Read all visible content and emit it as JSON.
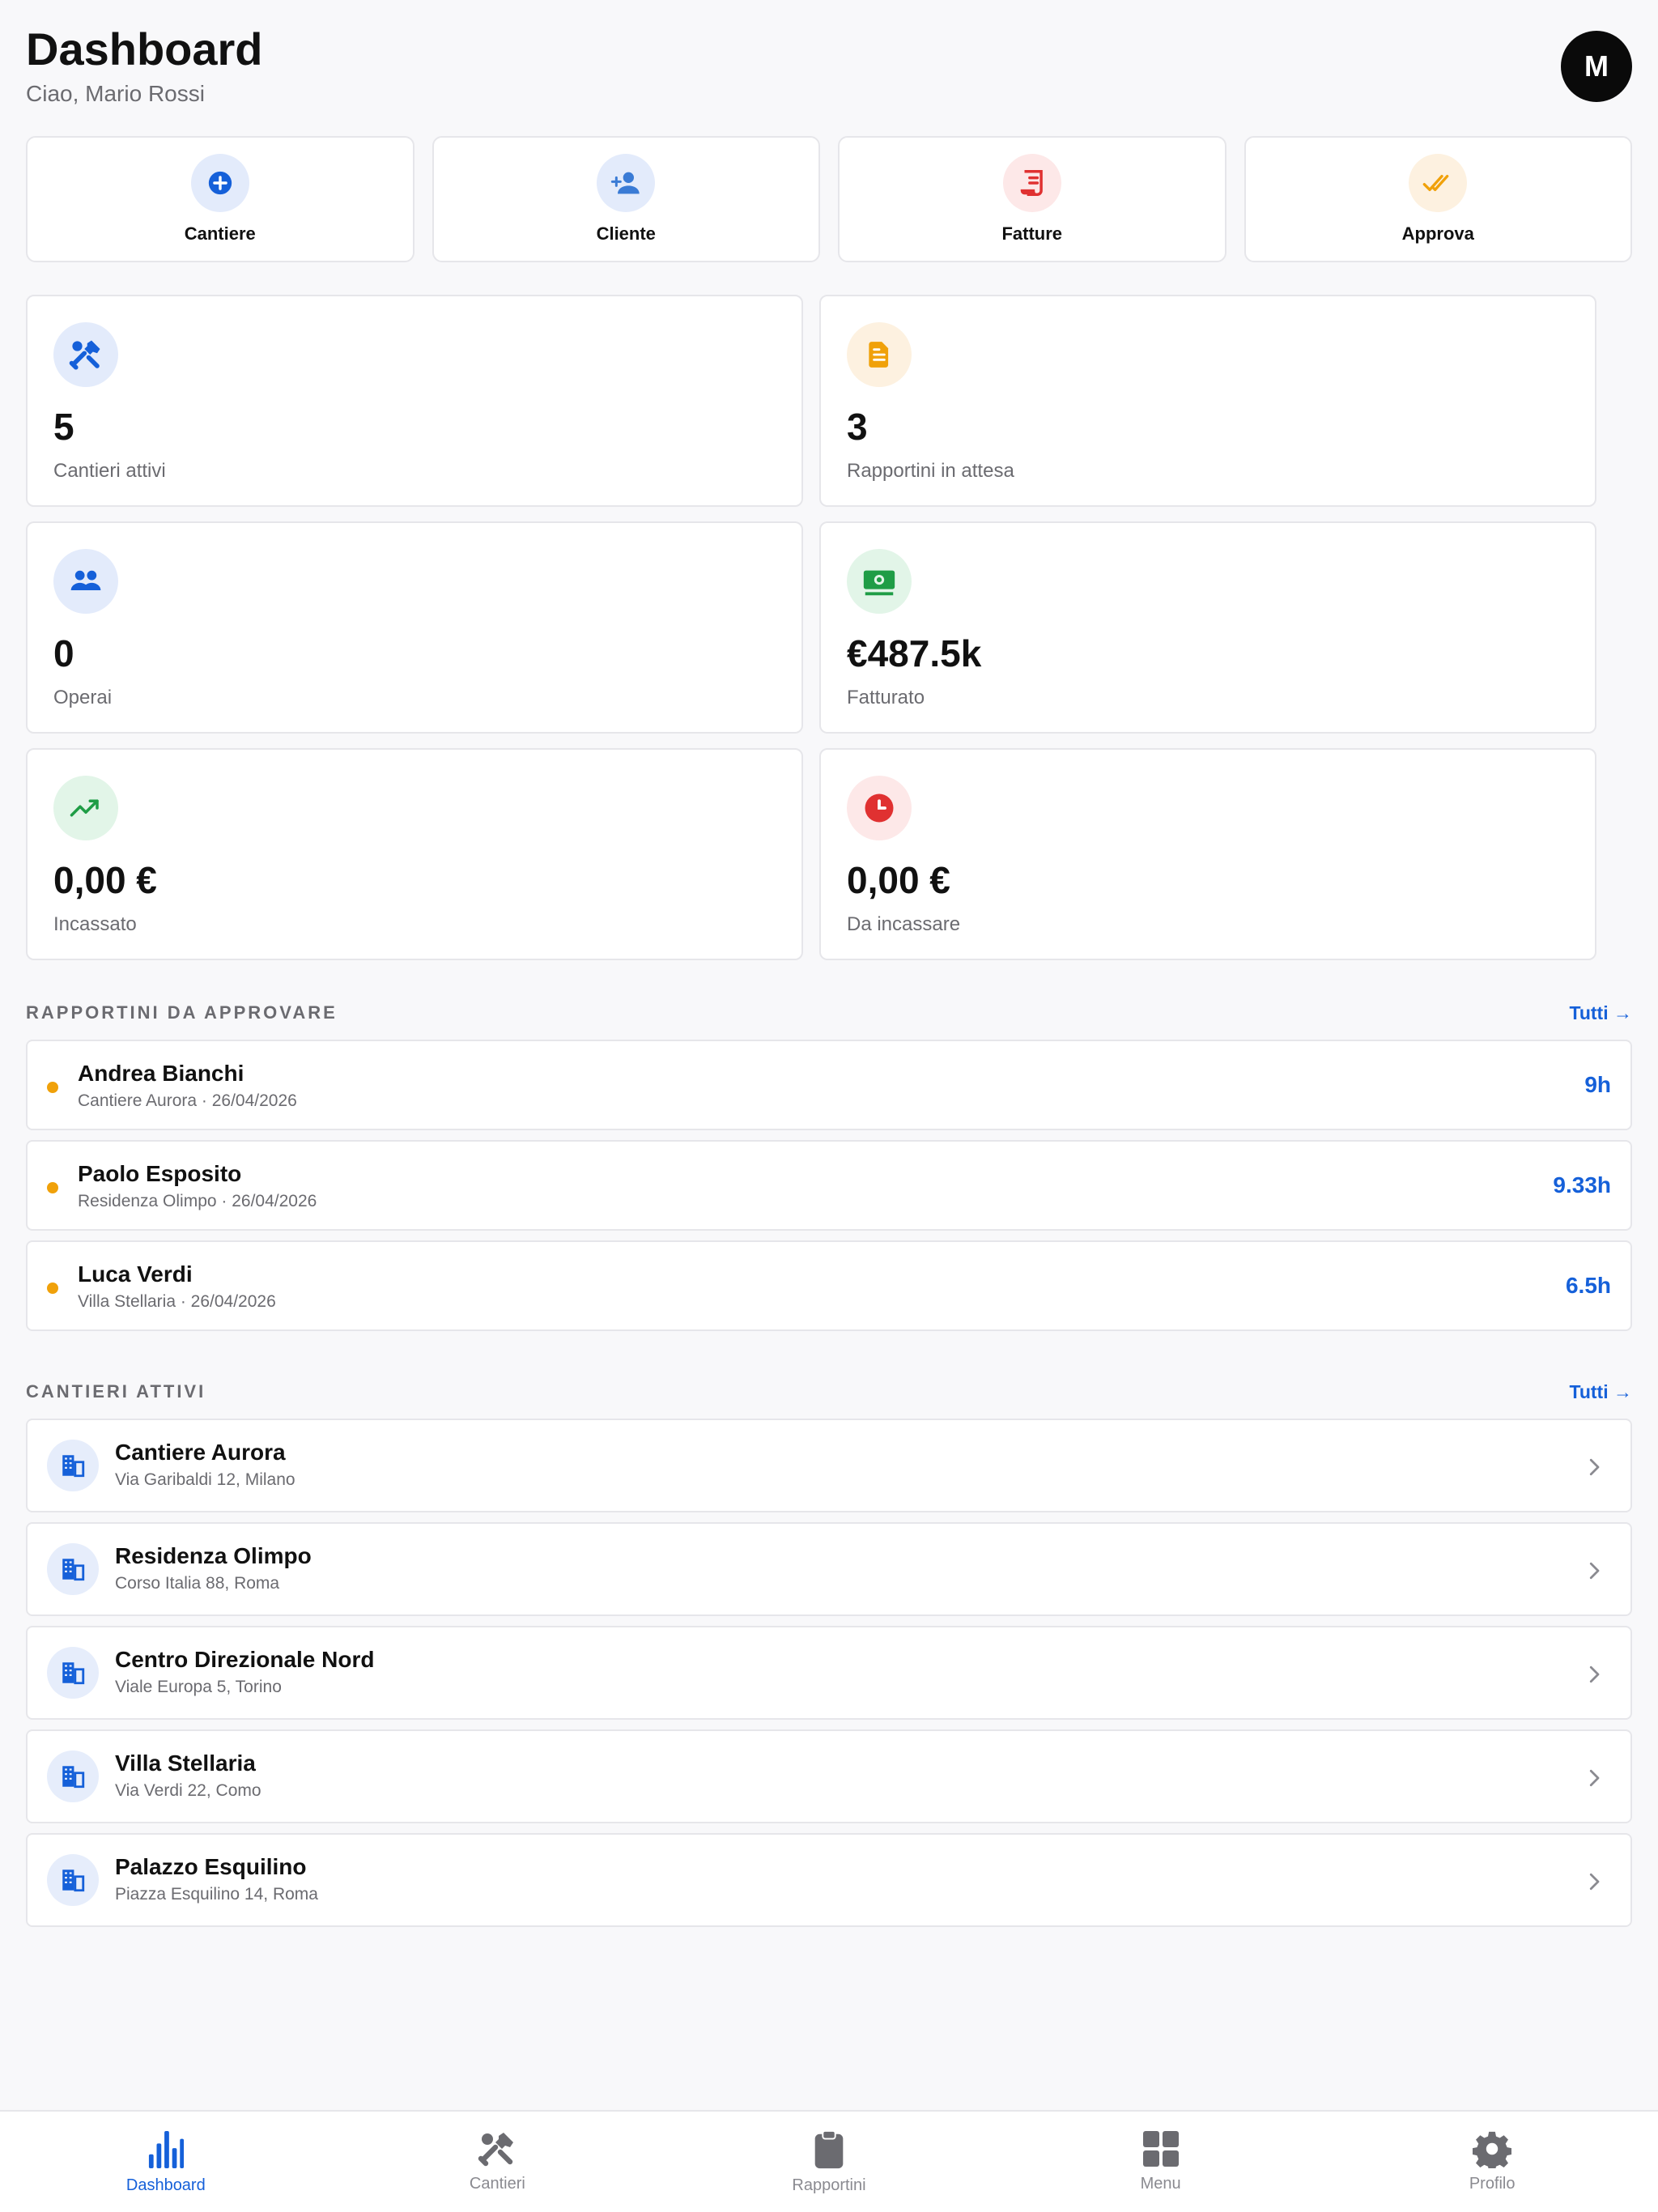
{
  "header": {
    "title": "Dashboard",
    "subtitle": "Ciao, Mario Rossi",
    "avatar_initial": "M"
  },
  "quick_actions": [
    {
      "label": "Cantiere",
      "icon": "plus-circle-icon",
      "bg": "#e3ebfb",
      "color": "#1560d9"
    },
    {
      "label": "Cliente",
      "icon": "add-user-icon",
      "bg": "#e3ebfb",
      "color": "#3a7bd5"
    },
    {
      "label": "Fatture",
      "icon": "invoice-icon",
      "bg": "#fde8e8",
      "color": "#e03131"
    },
    {
      "label": "Approva",
      "icon": "double-check-icon",
      "bg": "#fdf1e0",
      "color": "#f0a10a"
    }
  ],
  "stats": [
    {
      "value": "5",
      "label": "Cantieri attivi",
      "icon": "tools-icon",
      "bg": "#e3ebfb",
      "color": "#1560d9"
    },
    {
      "value": "3",
      "label": "Rapportini in attesa",
      "icon": "document-icon",
      "bg": "#fdf1e0",
      "color": "#f0a10a"
    },
    {
      "value": "0",
      "label": "Operai",
      "icon": "people-icon",
      "bg": "#e3ebfb",
      "color": "#1560d9"
    },
    {
      "value": "€487.5k",
      "label": "Fatturato",
      "icon": "money-icon",
      "bg": "#e2f5e8",
      "color": "#1f9d46"
    },
    {
      "value": "0,00 €",
      "label": "Incassato",
      "icon": "trend-up-icon",
      "bg": "#e2f5e8",
      "color": "#1f9d46"
    },
    {
      "value": "0,00 €",
      "label": "Da incassare",
      "icon": "clock-icon",
      "bg": "#fde8e8",
      "color": "#e03131"
    }
  ],
  "rapportini": {
    "title": "RAPPORTINI DA APPROVARE",
    "link": "Tutti →",
    "items": [
      {
        "name": "Andrea Bianchi",
        "sub": "Cantiere Aurora · 26/04/2026",
        "hours": "9h"
      },
      {
        "name": "Paolo Esposito",
        "sub": "Residenza Olimpo · 26/04/2026",
        "hours": "9.33h"
      },
      {
        "name": "Luca Verdi",
        "sub": "Villa Stellaria · 26/04/2026",
        "hours": "6.5h"
      }
    ]
  },
  "cantieri": {
    "title": "CANTIERI ATTIVI",
    "link": "Tutti →",
    "items": [
      {
        "name": "Cantiere Aurora",
        "address": "Via Garibaldi 12, Milano"
      },
      {
        "name": "Residenza Olimpo",
        "address": "Corso Italia 88, Roma"
      },
      {
        "name": "Centro Direzionale Nord",
        "address": "Viale Europa 5, Torino"
      },
      {
        "name": "Villa Stellaria",
        "address": "Via Verdi 22, Como"
      },
      {
        "name": "Palazzo Esquilino",
        "address": "Piazza Esquilino 14, Roma"
      }
    ]
  },
  "tabbar": [
    {
      "label": "Dashboard",
      "icon": "bar-chart-icon",
      "active": true
    },
    {
      "label": "Cantieri",
      "icon": "tools-icon",
      "active": false
    },
    {
      "label": "Rapportini",
      "icon": "clipboard-icon",
      "active": false
    },
    {
      "label": "Menu",
      "icon": "grid-icon",
      "active": false
    },
    {
      "label": "Profilo",
      "icon": "gear-icon",
      "active": false
    }
  ],
  "colors": {
    "accent": "#1560d9",
    "pending_dot": "#f0a10a",
    "muted_text": "#6b6b70"
  }
}
